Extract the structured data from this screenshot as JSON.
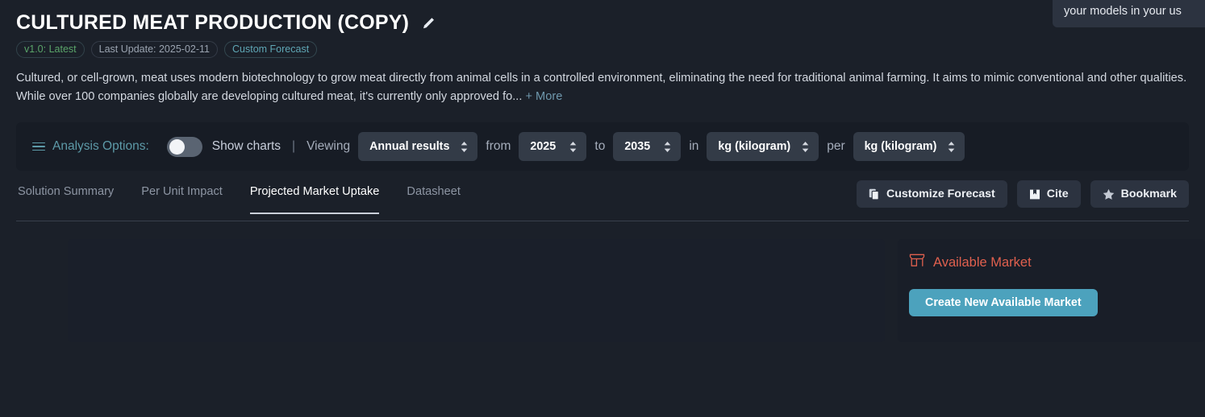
{
  "tooltip": {
    "text": "your models in your us"
  },
  "header": {
    "title": "Cultured Meat Production (Copy)",
    "edit_icon": "pencil-icon",
    "badges": {
      "version": "v1.0: Latest",
      "last_update": "Last Update: 2025-02-11",
      "custom": "Custom Forecast"
    },
    "badge_colors": {
      "version": "#5aa469",
      "last_update": "#9aa3b0",
      "custom": "#5fa7b5"
    }
  },
  "description": {
    "text": "Cultured, or cell-grown, meat uses modern biotechnology to grow meat directly from animal cells in a controlled environment, eliminating the need for traditional animal farming. It aims to mimic conventional and other qualities. While over 100 companies globally are developing cultured meat, it's currently only approved fo...",
    "more_label": "+ More"
  },
  "options_bar": {
    "menu_icon": "hamburger-icon",
    "label": "Analysis Options:",
    "toggle_state": "off",
    "toggle_label": "Show charts",
    "separator": "|",
    "viewing_label": "Viewing",
    "results_select": "Annual results",
    "from_label": "from",
    "from_year": "2025",
    "to_label": "to",
    "to_year": "2035",
    "in_label": "in",
    "in_unit": "kg (kilogram)",
    "per_label": "per",
    "per_unit": "kg (kilogram)"
  },
  "tabs": [
    {
      "label": "Solution Summary",
      "active": false
    },
    {
      "label": "Per Unit Impact",
      "active": false
    },
    {
      "label": "Projected Market Uptake",
      "active": true
    },
    {
      "label": "Datasheet",
      "active": false
    }
  ],
  "actions": [
    {
      "label": "Customize Forecast",
      "icon": "copy-icon"
    },
    {
      "label": "Cite",
      "icon": "book-icon"
    },
    {
      "label": "Bookmark",
      "icon": "star-icon"
    }
  ],
  "market_panel": {
    "icon": "store-icon",
    "title": "Available Market",
    "title_color": "#e0604e",
    "create_label": "Create New Available Market",
    "create_color": "#4ca2bd"
  }
}
